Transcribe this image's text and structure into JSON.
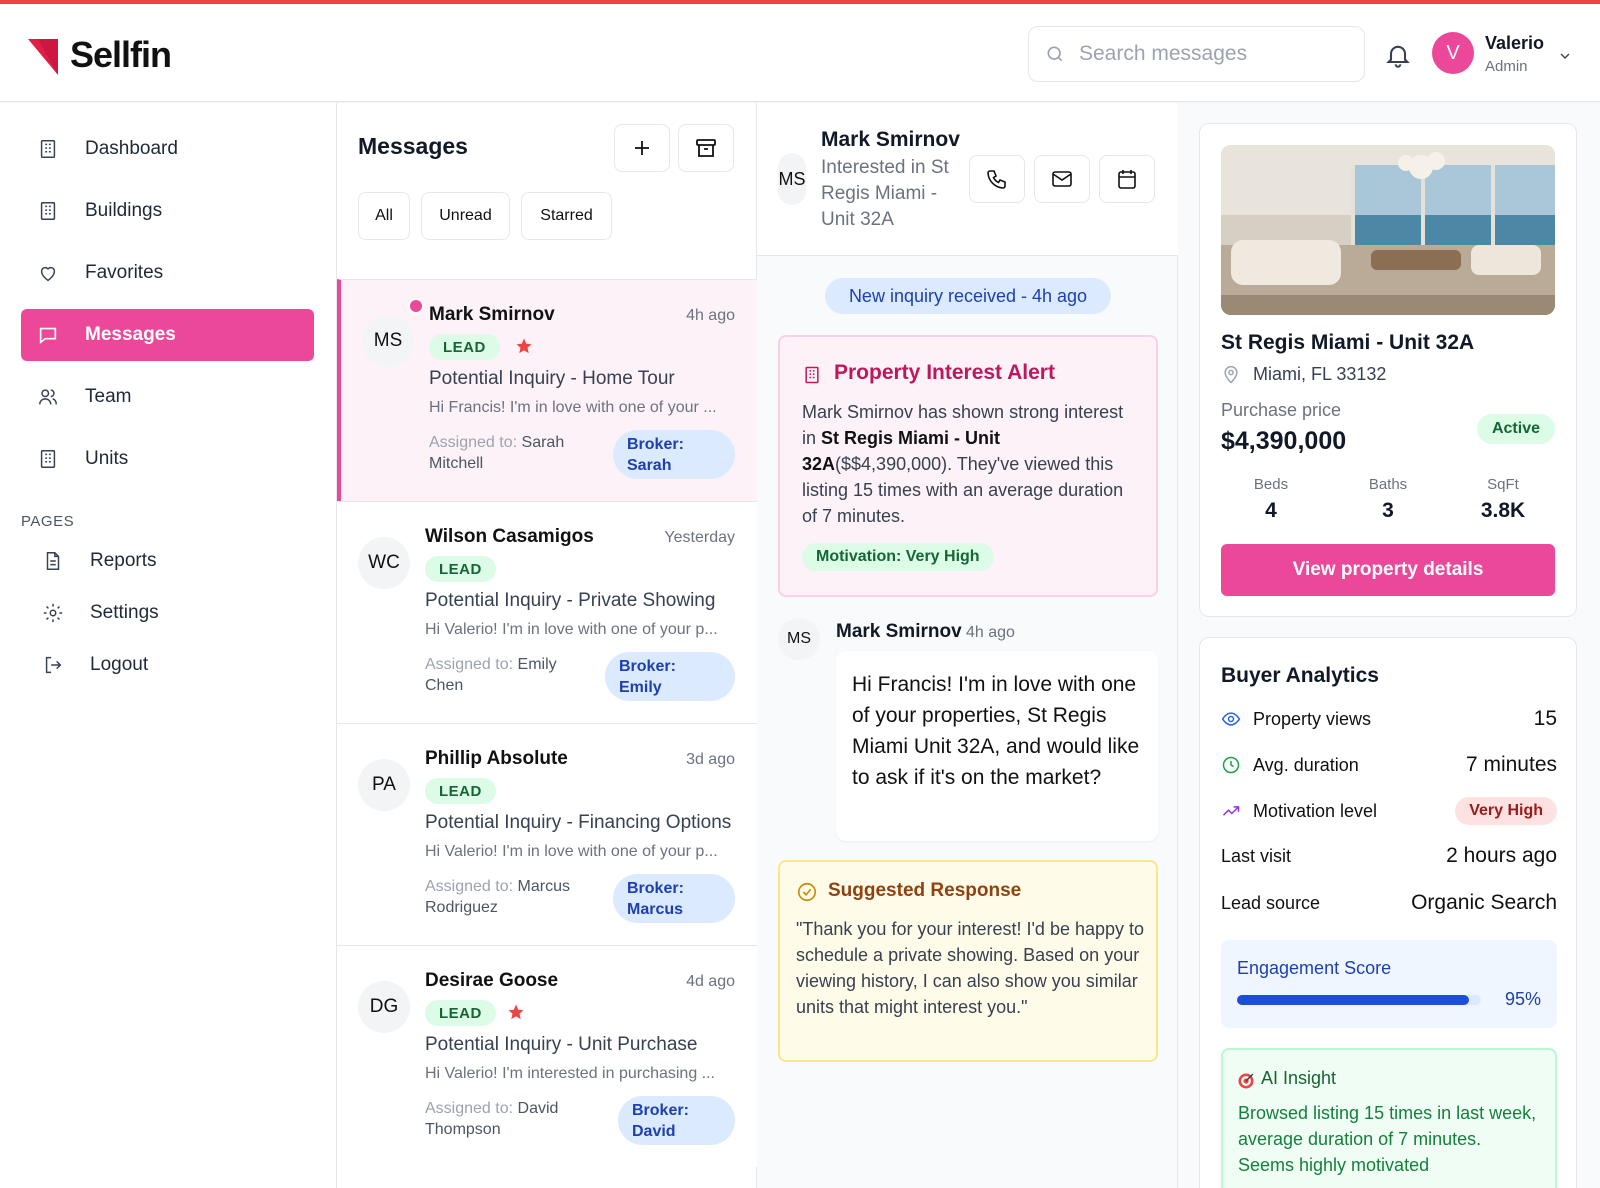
{
  "brand": {
    "name": "Sellfin",
    "accent": "#ec4899"
  },
  "header": {
    "search_placeholder": "Search messages",
    "user": {
      "initial": "V",
      "name": "Valerio",
      "role": "Admin"
    }
  },
  "sidebar": {
    "items": [
      {
        "label": "Dashboard",
        "icon": "building-icon"
      },
      {
        "label": "Buildings",
        "icon": "building-icon"
      },
      {
        "label": "Favorites",
        "icon": "heart-icon"
      },
      {
        "label": "Messages",
        "icon": "message-icon",
        "active": true
      },
      {
        "label": "Team",
        "icon": "users-icon"
      },
      {
        "label": "Units",
        "icon": "building-icon"
      }
    ],
    "pages_label": "PAGES",
    "pages": [
      {
        "label": "Reports",
        "icon": "file-icon"
      },
      {
        "label": "Settings",
        "icon": "gear-icon"
      },
      {
        "label": "Logout",
        "icon": "logout-icon"
      }
    ]
  },
  "messages": {
    "title": "Messages",
    "filters": [
      "All",
      "Unread",
      "Starred"
    ],
    "conversations": [
      {
        "initials": "MS",
        "name": "Mark Smirnov",
        "time": "4h ago",
        "tag": "LEAD",
        "starred": true,
        "unread": true,
        "subject": "Potential Inquiry - Home Tour",
        "preview": "Hi Francis! I'm in love with one of your ...",
        "assigned_label": "Assigned to:",
        "assigned_to": "Sarah Mitchell",
        "broker_label": "Broker:",
        "broker": "Sarah"
      },
      {
        "initials": "WC",
        "name": "Wilson Casamigos",
        "time": "Yesterday",
        "tag": "LEAD",
        "starred": false,
        "unread": false,
        "subject": "Potential Inquiry - Private Showing",
        "preview": "Hi Valerio! I'm in love with one of your p...",
        "assigned_label": "Assigned to:",
        "assigned_to": "Emily Chen",
        "broker_label": "Broker:",
        "broker": "Emily"
      },
      {
        "initials": "PA",
        "name": "Phillip Absolute",
        "time": "3d ago",
        "tag": "LEAD",
        "starred": false,
        "unread": false,
        "subject": "Potential Inquiry - Financing Options",
        "preview": "Hi Valerio! I'm in love with one of your p...",
        "assigned_label": "Assigned to:",
        "assigned_to": "Marcus Rodriguez",
        "broker_label": "Broker:",
        "broker": "Marcus"
      },
      {
        "initials": "DG",
        "name": "Desirae Goose",
        "time": "4d ago",
        "tag": "LEAD",
        "starred": true,
        "unread": false,
        "subject": "Potential Inquiry - Unit Purchase",
        "preview": "Hi Valerio! I'm interested in purchasing ...",
        "assigned_label": "Assigned to:",
        "assigned_to": "David Thompson",
        "broker_label": "Broker:",
        "broker": "David"
      }
    ]
  },
  "chat": {
    "initials": "MS",
    "name": "Mark Smirnov",
    "subtitle": "Interested in St Regis Miami - Unit 32A",
    "event": "New inquiry received - 4h ago",
    "alert": {
      "title": "Property Interest Alert",
      "body_pre": "Mark Smirnov has shown strong interest in ",
      "body_bold": "St Regis Miami - Unit 32A",
      "body_post": "($$4,390,000). They've viewed this listing 15 times with an average duration of 7 minutes.",
      "motivation": "Motivation: Very High"
    },
    "message": {
      "initials": "MS",
      "name": "Mark Smirnov",
      "time": "4h ago",
      "text": "Hi Francis! I'm in love with one of your properties, St Regis Miami Unit 32A, and would like to ask if it's on the market?"
    },
    "suggested": {
      "title": "Suggested Response",
      "text": "\"Thank you for your interest! I'd be happy to schedule a private showing. Based on your viewing history, I can also show you similar units that might interest you.\""
    }
  },
  "property": {
    "title": "St Regis Miami - Unit 32A",
    "location": "Miami, FL 33132",
    "price_label": "Purchase price",
    "price": "$4,390,000",
    "status": "Active",
    "stats": [
      {
        "label": "Beds",
        "value": "4"
      },
      {
        "label": "Baths",
        "value": "3"
      },
      {
        "label": "SqFt",
        "value": "3.8K"
      }
    ],
    "cta": "View property details"
  },
  "analytics": {
    "title": "Buyer Analytics",
    "rows": {
      "views": {
        "label": "Property views",
        "value": "15"
      },
      "duration": {
        "label": "Avg. duration",
        "value": "7 minutes"
      },
      "motivation": {
        "label": "Motivation level",
        "value": "Very High"
      },
      "last_visit": {
        "label": "Last visit",
        "value": "2 hours ago"
      },
      "lead_source": {
        "label": "Lead source",
        "value": "Organic Search"
      }
    },
    "engagement": {
      "title": "Engagement Score",
      "value": 95,
      "label": "95%"
    },
    "ai": {
      "title": "AI Insight",
      "text": "Browsed listing 15 times in last week, average duration of 7 minutes. Seems highly motivated"
    }
  }
}
